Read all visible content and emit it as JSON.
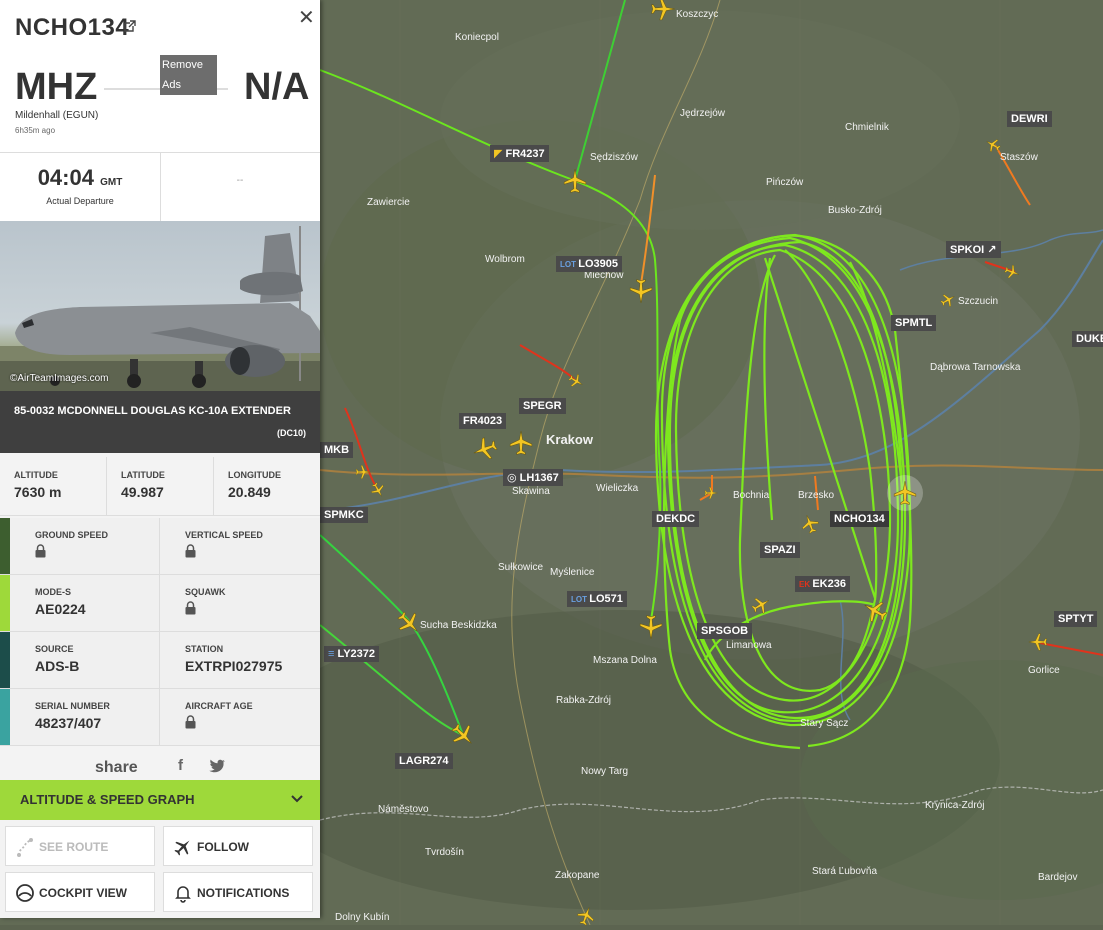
{
  "panel": {
    "callsign": "NCHO134",
    "from_code": "MHZ",
    "to_code": "N/A",
    "from_name": "Mildenhall (EGUN)",
    "from_ago": "6h35m ago",
    "remove_ads": "Remove Ads",
    "departure_time": "04:04",
    "departure_tz": "GMT",
    "departure_label": "Actual Departure",
    "arrival_placeholder": "--",
    "photo_credit": "©AirTeamImages.com",
    "aircraft_name": "85-0032 MCDONNELL DOUGLAS KC-10A EXTENDER",
    "aircraft_code": "(DC10)",
    "altitude_label": "ALTITUDE",
    "altitude_value": "7630 m",
    "latitude_label": "LATITUDE",
    "latitude_value": "49.987",
    "longitude_label": "LONGITUDE",
    "longitude_value": "20.849",
    "ground_speed_label": "GROUND SPEED",
    "vertical_speed_label": "VERTICAL SPEED",
    "mode_s_label": "MODE-S",
    "mode_s_value": "AE0224",
    "squawk_label": "SQUAWK",
    "source_label": "SOURCE",
    "source_value": "ADS-B",
    "station_label": "STATION",
    "station_value": "EXTRPI027975",
    "serial_label": "SERIAL NUMBER",
    "serial_value": "48237/407",
    "age_label": "AIRCRAFT AGE",
    "share_label": "share",
    "graph_label": "ALTITUDE & SPEED GRAPH",
    "btn_route": "SEE ROUTE",
    "btn_follow": "FOLLOW",
    "btn_cockpit": "COCKPIT VIEW",
    "btn_notifications": "NOTIFICATIONS",
    "colors": {
      "accent_green": "#9ed93a",
      "track_green": "#7ee81e",
      "bar_dark_green": "#3d5e2f",
      "bar_light_green": "#9ed93a",
      "bar_teal_dark": "#1c4d4a",
      "bar_teal": "#3aa3a0",
      "plane_yellow": "#f3c623"
    }
  },
  "map": {
    "cities": [
      "Koniecpol",
      "Jędrzejów",
      "Chmielnik",
      "Sędziszów",
      "Staszów",
      "Zawiercie",
      "Pińczów",
      "Busko-Zdrój",
      "Wolbrom",
      "Miechów",
      "Szczucin",
      "Dąbrowa Tarnowska",
      "Krakow",
      "Skawina",
      "Wieliczka",
      "Bochnia",
      "Brzesko",
      "Sułkowice",
      "Myślenice",
      "Limanowa",
      "Mszana Dolna",
      "Rabka-Zdrój",
      "Nowy Targ",
      "Stary Sącz",
      "Gorlice",
      "Krynica-Zdrój",
      "Náměstovo",
      "Tvrdošín",
      "Zakopane",
      "Stará Ľubovňa",
      "Bardejov",
      "Dolny Kubín",
      "Koszczyc",
      "Sucha Beskidzka"
    ],
    "flights": [
      "FR4237",
      "LO3905",
      "SPKOI",
      "DEWRI",
      "SPMTL",
      "DUKE",
      "FR4023",
      "SPEGR",
      "LH1367",
      "MKB",
      "SPMKC",
      "DEKDC",
      "NCHO134",
      "SPAZI",
      "EK236",
      "LO571",
      "SPSGOB",
      "SPTYT",
      "LY2372",
      "LAGR274"
    ]
  }
}
